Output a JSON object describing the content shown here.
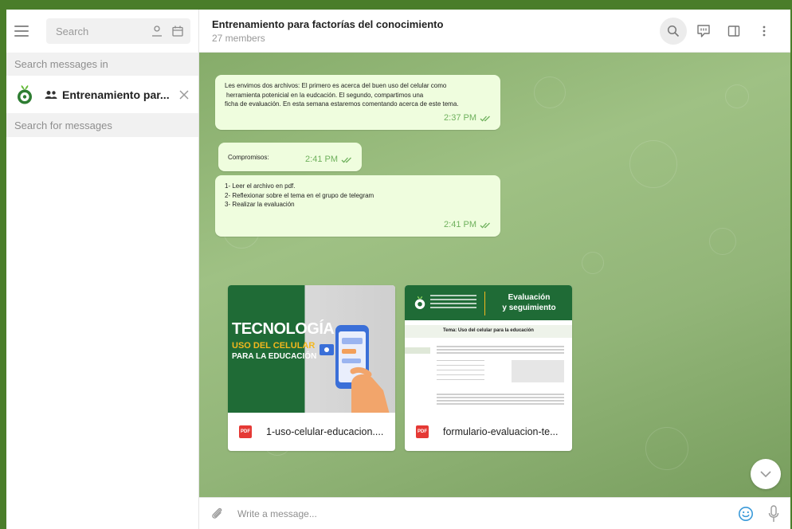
{
  "sidebar": {
    "search_placeholder": "Search",
    "search_in_label": "Search messages in",
    "chat_name": "Entrenamiento par...",
    "search_for_label": "Search for messages"
  },
  "header": {
    "title": "Entrenamiento para factorías del conocimiento",
    "members": "27 members"
  },
  "messages": [
    {
      "lines": [
        "Les envimos dos archivos: El primero es acerca del buen uso del celular como",
        "herramienta potenicial en la eudcación. El segundo, compartimos una",
        "ficha de evaluación. En esta semana estaremos comentando acerca de este tema."
      ],
      "time": "2:37 PM"
    },
    {
      "lines": [
        "Compromisos:"
      ],
      "time": "2:41 PM"
    },
    {
      "lines": [
        "1- Leer el archivo en pdf.",
        "2- Reflexionar sobre el tema en el grupo de telegram",
        "3- Realizar la evaluación"
      ],
      "time": "2:41 PM"
    }
  ],
  "documents": [
    {
      "name": "1-uso-celular-educacion....",
      "badge": "PDF",
      "cover_title": "TECNOLOGÍA",
      "cover_sub1": "USO DEL CELULAR",
      "cover_sub2": "PARA LA EDUCACIÓN"
    },
    {
      "name": "formulario-evaluacion-te...",
      "badge": "PDF",
      "cover_title": "Evaluación",
      "cover_title2": "y seguimiento",
      "cover_topic": "Tema: Uso del celular para la educación"
    }
  ],
  "composer": {
    "placeholder": "Write a message..."
  },
  "colors": {
    "bubble": "#effdde",
    "check": "#6fb15d",
    "brand_green": "#1f6b36",
    "frame": "#4a7d2a"
  }
}
